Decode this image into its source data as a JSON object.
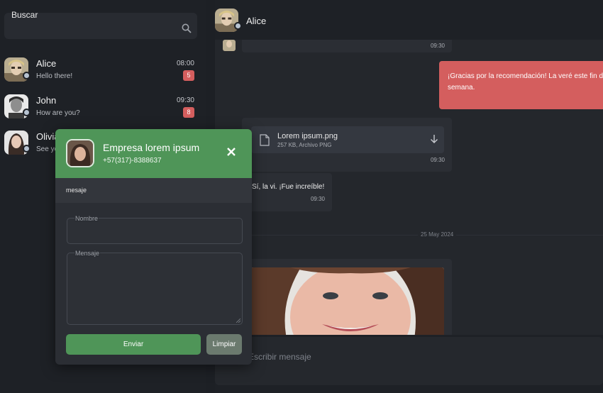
{
  "search": {
    "label": "Buscar",
    "icon": "search-icon"
  },
  "contacts": [
    {
      "name": "Alice",
      "preview": "Hello there!",
      "time": "08:00",
      "unread": "5"
    },
    {
      "name": "John",
      "preview": "How are you?",
      "time": "09:30",
      "unread": "8"
    },
    {
      "name": "Olivia",
      "preview": "See you"
    }
  ],
  "chat": {
    "contact_name": "Alice",
    "messages": {
      "first_time": "09:30",
      "outgoing_text": "¡Gracias por la recomendación! La veré este fin de semana.",
      "file": {
        "name": "Lorem ipsum.png",
        "meta": "257 KB, Archivo PNG",
        "time": "09:30"
      },
      "reply_text": "Sí, la vi. ¡Fue increíble!",
      "reply_time": "09:30"
    },
    "date_separator": "25 May 2024",
    "composer_placeholder": "Escribir mensaje"
  },
  "popup": {
    "company": "Empresa lorem ipsum",
    "phone": "+57(317)-8388637",
    "tab_label": "mesaje",
    "fields": {
      "name_label": "Nombre",
      "message_label": "Mensaje"
    },
    "send_label": "Enviar",
    "clear_label": "Limpiar"
  },
  "colors": {
    "accent_green": "#4f9558",
    "accent_red": "#d45e5e",
    "background": "#1d2025",
    "panel": "#2b2e34"
  }
}
